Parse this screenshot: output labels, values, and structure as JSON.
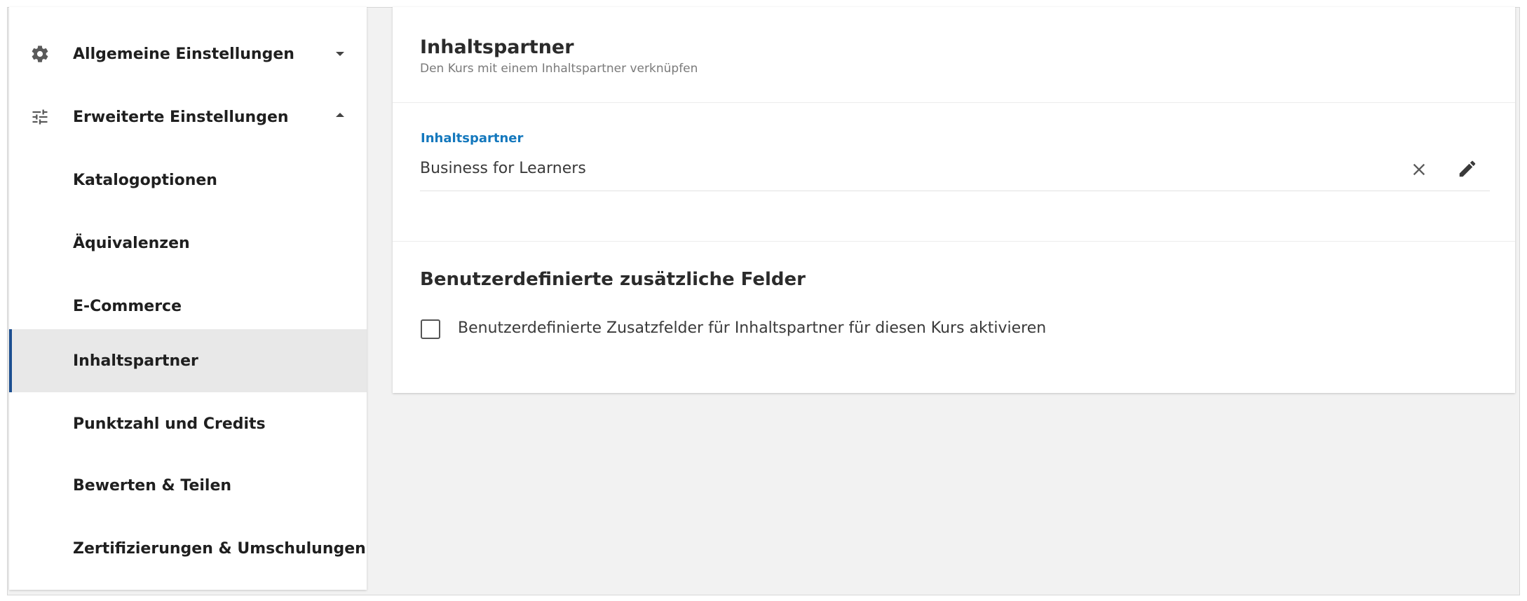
{
  "sidebar": {
    "items": [
      {
        "label": "Allgemeine Einstellungen",
        "icon": "gear-icon",
        "chevron": "down"
      },
      {
        "label": "Erweiterte Einstellungen",
        "icon": "sliders-icon",
        "chevron": "up"
      },
      {
        "label": "Katalogoptionen"
      },
      {
        "label": "Äquivalenzen"
      },
      {
        "label": "E-Commerce"
      },
      {
        "label": "Inhaltspartner",
        "active": true
      },
      {
        "label": "Punktzahl und Credits"
      },
      {
        "label": "Bewerten & Teilen"
      },
      {
        "label": "Zertifizierungen & Umschulungen"
      }
    ]
  },
  "card": {
    "title": "Inhaltspartner",
    "subtitle": "Den Kurs mit einem Inhaltspartner verknüpfen",
    "field": {
      "label": "Inhaltspartner",
      "value": "Business for Learners"
    },
    "custom_fields": {
      "title": "Benutzerdefinierte zusätzliche Felder",
      "checkbox_label": "Benutzerdefinierte Zusatzfelder für Inhaltspartner für diesen Kurs aktivieren",
      "checked": false
    }
  },
  "colors": {
    "accent": "#1478bd",
    "active_bar": "#1d4f91",
    "active_bg": "#e8e8e8",
    "background": "#f2f2f2"
  }
}
